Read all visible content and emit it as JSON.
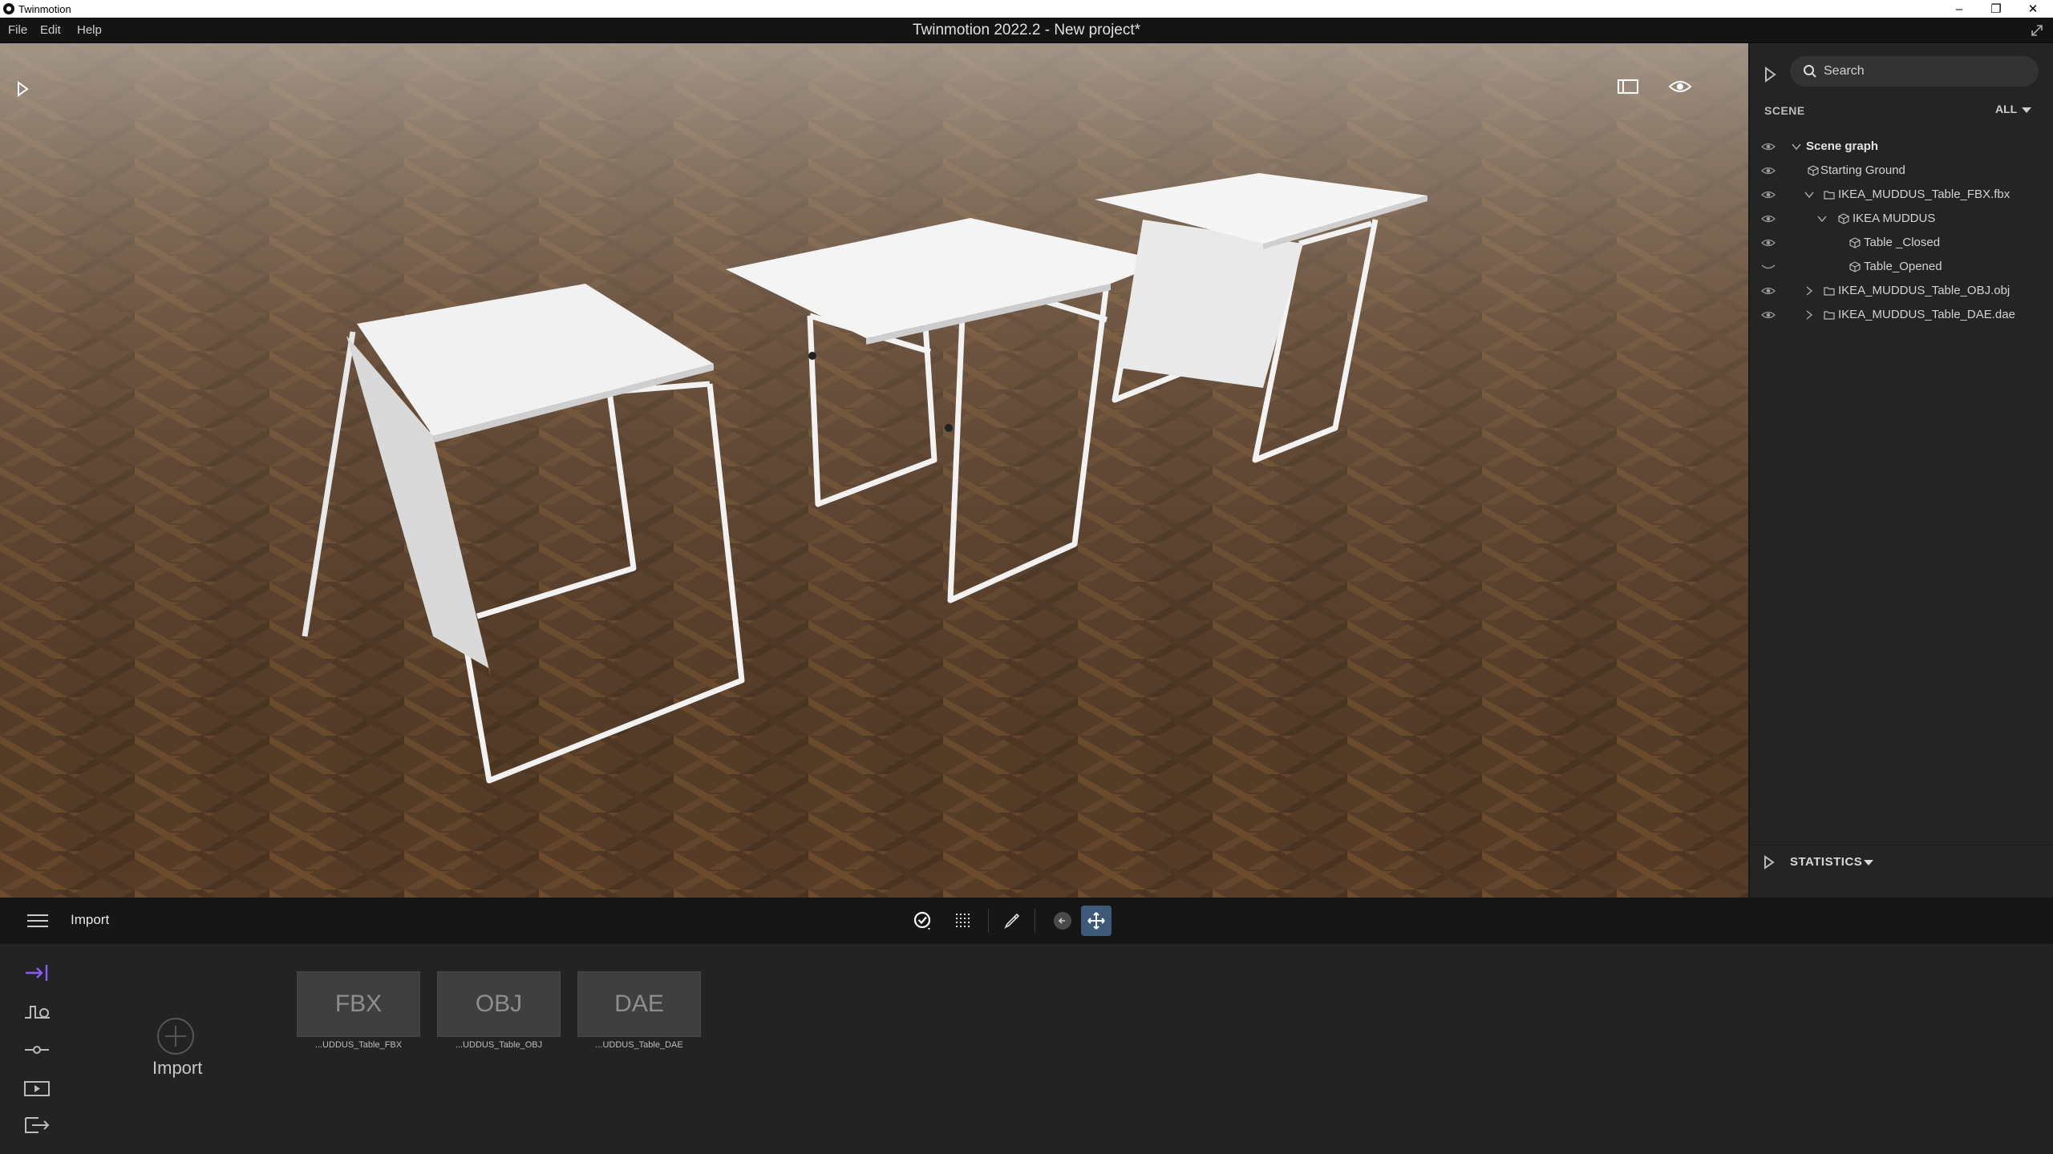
{
  "os_bar": {
    "app_name": "Twinmotion",
    "minimize": "–",
    "restore": "❐",
    "close": "✕"
  },
  "menu": {
    "items": [
      "File",
      "Edit",
      "Help"
    ],
    "window_title": "Twinmotion 2022.2 - New project*"
  },
  "scene_panel": {
    "search_placeholder": "Search",
    "section_label": "SCENE",
    "filter": "ALL",
    "tree": [
      {
        "label": "Scene graph",
        "visible": true,
        "expanded": true
      },
      {
        "label": "Starting Ground",
        "visible": true
      },
      {
        "label": "IKEA_MUDDUS_Table_FBX.fbx",
        "visible": true,
        "expanded": true
      },
      {
        "label": "IKEA MUDDUS",
        "visible": true,
        "expanded": true
      },
      {
        "label": "Table _Closed",
        "visible": true
      },
      {
        "label": "Table_Opened",
        "visible": false
      },
      {
        "label": "IKEA_MUDDUS_Table_OBJ.obj",
        "visible": true,
        "expanded": false
      },
      {
        "label": "IKEA_MUDDUS_Table_DAE.dae",
        "visible": true,
        "expanded": false
      }
    ],
    "statistics_label": "STATISTICS"
  },
  "toolbar": {
    "title": "Import"
  },
  "dock": {
    "import_label": "Import",
    "assets": [
      {
        "badge": "FBX",
        "caption": "...UDDUS_Table_FBX"
      },
      {
        "badge": "OBJ",
        "caption": "...UDDUS_Table_OBJ"
      },
      {
        "badge": "DAE",
        "caption": "...UDDUS_Table_DAE"
      }
    ]
  },
  "colors": {
    "accent": "#8a5cf5",
    "selected_tool": "#3d5a78",
    "panel_bg": "#242424",
    "floor": "#5a3f2a"
  }
}
